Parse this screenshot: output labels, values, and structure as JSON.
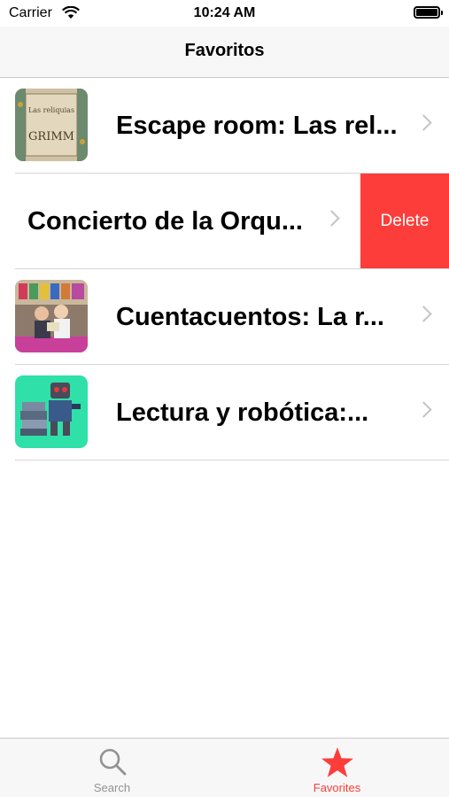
{
  "status": {
    "carrier": "Carrier",
    "time": "10:24 AM"
  },
  "nav": {
    "title": "Favoritos"
  },
  "favorites": [
    {
      "title": "Escape room: Las rel..."
    },
    {
      "title": "Concierto de la Orqu...",
      "swipe_action": "Delete"
    },
    {
      "title": "Cuentacuentos: La r..."
    },
    {
      "title": "Lectura y robótica:..."
    }
  ],
  "thumbnail_text": {
    "book_top": "Las reliquias",
    "book_title": "GRIMM"
  },
  "tabs": [
    {
      "label": "Search",
      "icon": "search-icon",
      "selected": false
    },
    {
      "label": "Favorites",
      "icon": "star-icon",
      "selected": true
    }
  ],
  "colors": {
    "accent": "#fc3d39",
    "tab_inactive": "#929292",
    "delete_bg": "#fc3d39",
    "thumb_robot_bg": "#2fe0a8"
  }
}
